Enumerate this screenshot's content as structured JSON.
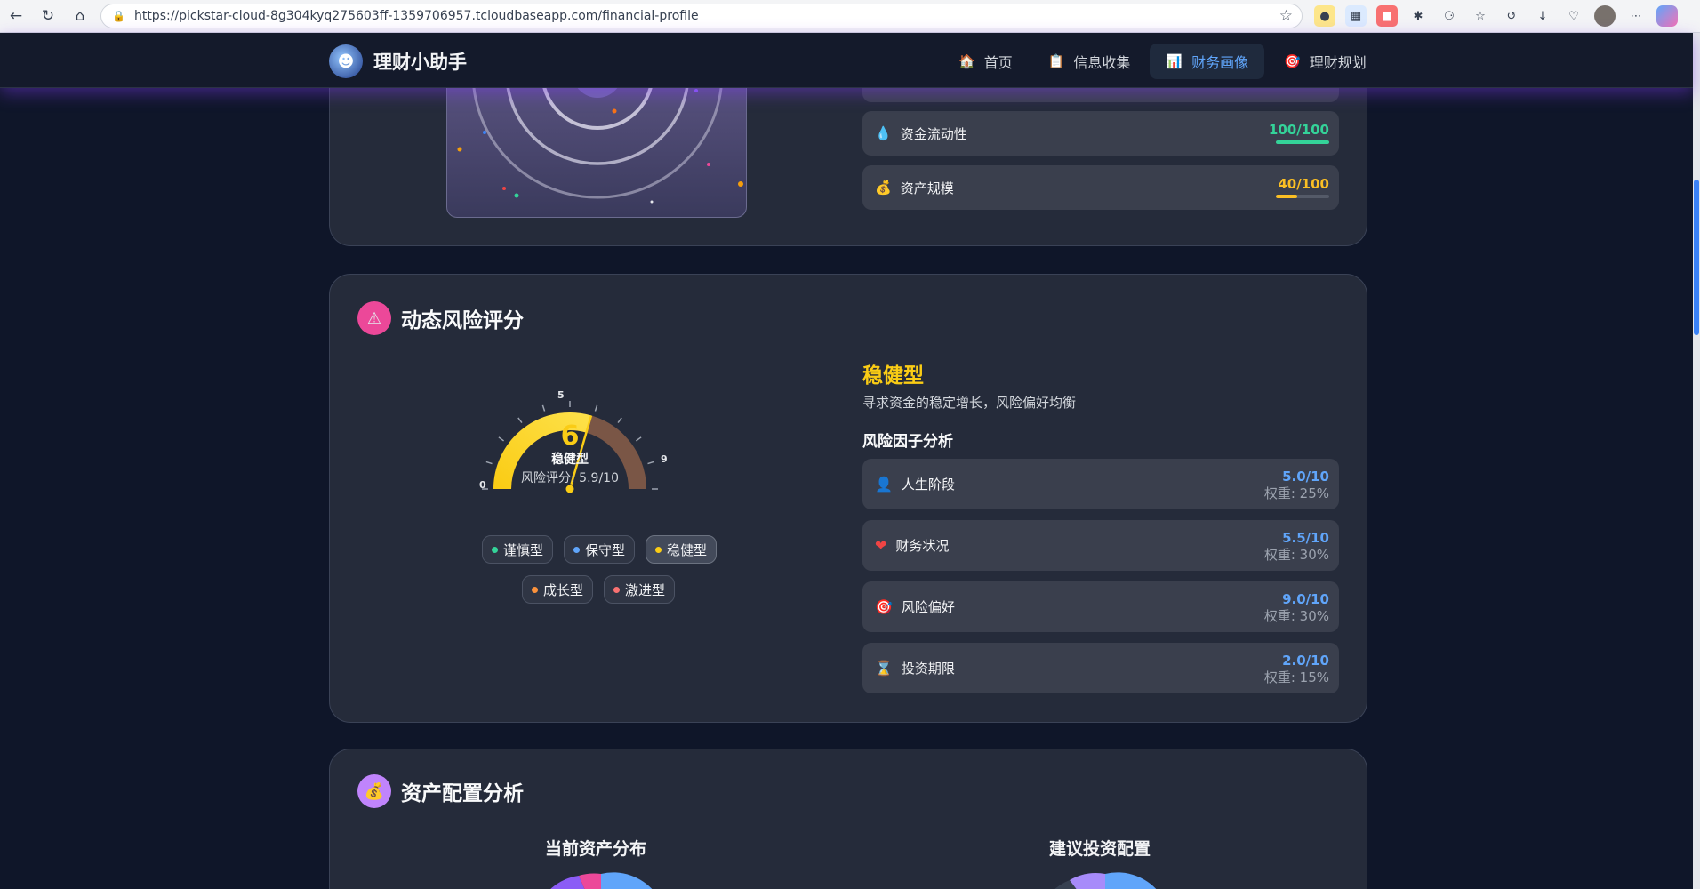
{
  "browser": {
    "url": "https://pickstar-cloud-8g304kyq275603ff-1359706957.tcloudbaseapp.com/financial-profile"
  },
  "app": {
    "brand": "理财小助手",
    "nav": [
      {
        "label": "首页",
        "icon": "house-icon",
        "active": false
      },
      {
        "label": "信息收集",
        "icon": "clipboard-icon",
        "active": false
      },
      {
        "label": "财务画像",
        "icon": "bar-chart-icon",
        "active": true
      },
      {
        "label": "理财规划",
        "icon": "target-icon",
        "active": false
      }
    ]
  },
  "top_card": {
    "metrics": [
      {
        "label": "资金流动性",
        "value": "100/100",
        "score": 100,
        "color": "#34d399",
        "icon": "droplet-icon"
      },
      {
        "label": "资产规模",
        "value": "40/100",
        "score": 40,
        "color": "#fbbf24",
        "icon": "money-bag-icon"
      }
    ]
  },
  "risk_card": {
    "title": "动态风险评分",
    "gauge": {
      "score_rounded": "6",
      "type_label": "稳健型",
      "score_text": "风险评分: 5.9/10",
      "score": 5.9,
      "tick_labels": [
        "0",
        "5",
        "9"
      ]
    },
    "chips": [
      {
        "label": "谨慎型",
        "color": "#34d399",
        "active": false
      },
      {
        "label": "保守型",
        "color": "#60a5fa",
        "active": false
      },
      {
        "label": "稳健型",
        "color": "#facc15",
        "active": true
      },
      {
        "label": "成长型",
        "color": "#fb923c",
        "active": false
      },
      {
        "label": "激进型",
        "color": "#f87171",
        "active": false
      }
    ],
    "risk_type": "稳健型",
    "risk_desc": "寻求资金的稳定增长，风险偏好均衡",
    "factor_heading": "风险因子分析",
    "factors": [
      {
        "label": "人生阶段",
        "score": "5.0/10",
        "weight": "权重: 25%",
        "icon": "person-icon"
      },
      {
        "label": "财务状况",
        "score": "5.5/10",
        "weight": "权重: 30%",
        "icon": "heart-icon"
      },
      {
        "label": "风险偏好",
        "score": "9.0/10",
        "weight": "权重: 30%",
        "icon": "target-icon"
      },
      {
        "label": "投资期限",
        "score": "2.0/10",
        "weight": "权重: 15%",
        "icon": "hourglass-icon"
      }
    ]
  },
  "alloc_card": {
    "title": "资产配置分析",
    "current_title": "当前资产分布",
    "suggested_title": "建议投资配置"
  }
}
